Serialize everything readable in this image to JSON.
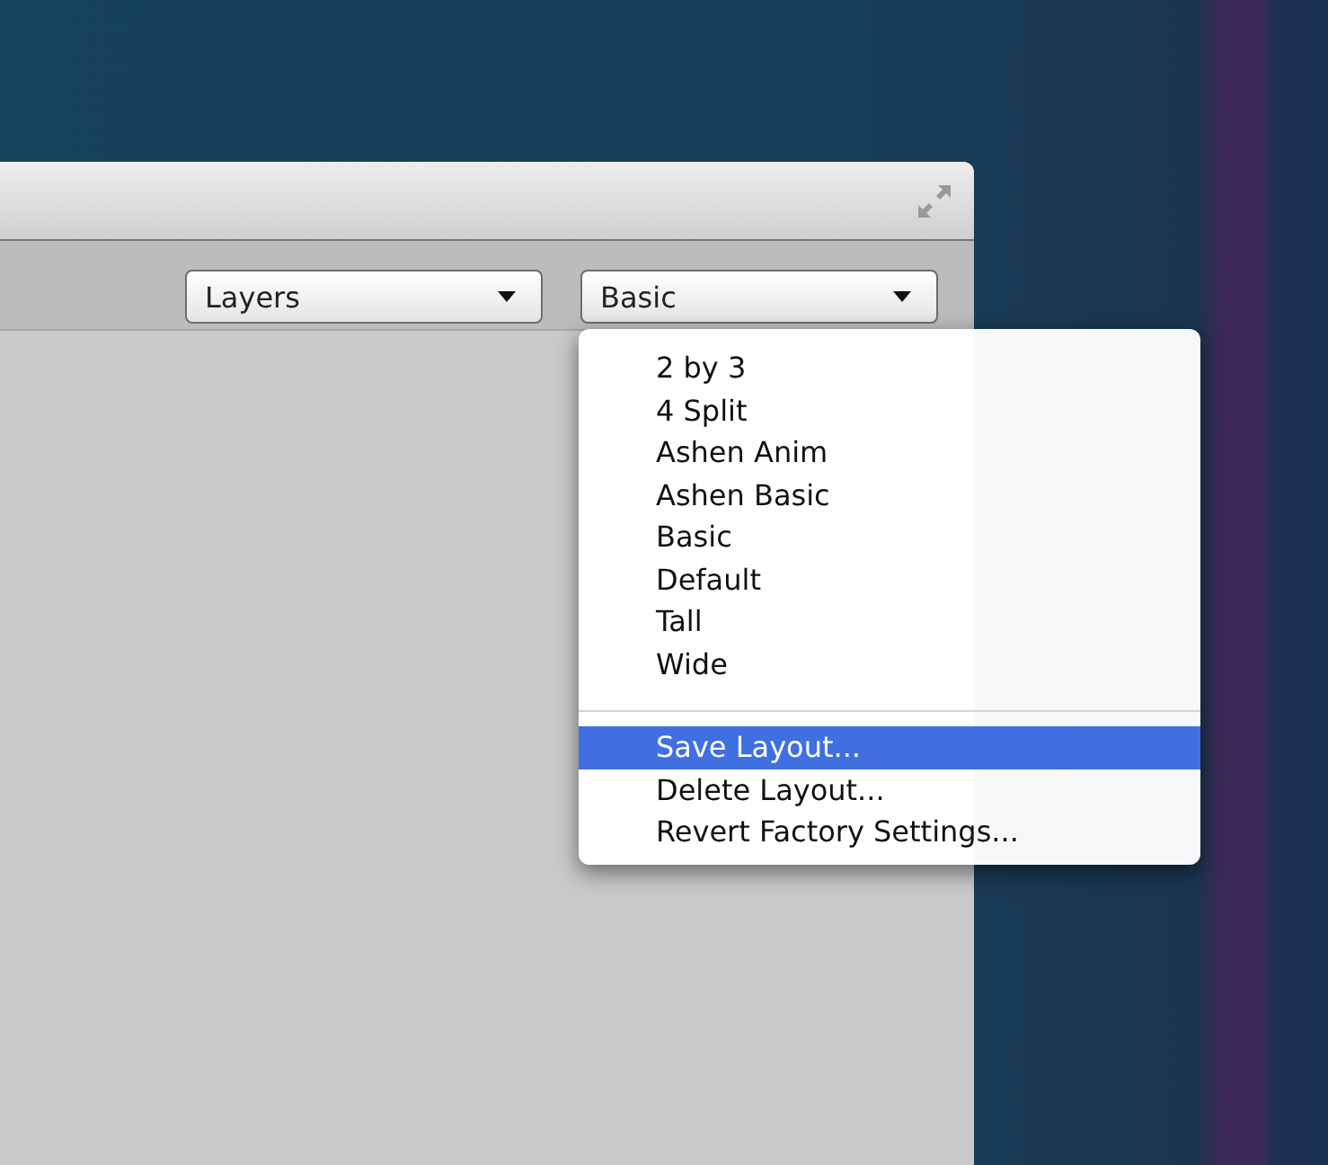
{
  "toolbar": {
    "dropdowns": [
      {
        "label": "Layers"
      },
      {
        "label": "Basic"
      }
    ]
  },
  "menu": {
    "groups": [
      [
        {
          "label": "2 by 3",
          "selected": false
        },
        {
          "label": "4 Split",
          "selected": false
        },
        {
          "label": "Ashen Anim",
          "selected": false
        },
        {
          "label": "Ashen Basic",
          "selected": false
        },
        {
          "label": "Basic",
          "selected": false
        },
        {
          "label": "Default",
          "selected": false
        },
        {
          "label": "Tall",
          "selected": false
        },
        {
          "label": "Wide",
          "selected": false
        }
      ],
      [
        {
          "label": "Save Layout...",
          "selected": true
        },
        {
          "label": "Delete Layout...",
          "selected": false
        },
        {
          "label": "Revert Factory Settings...",
          "selected": false
        }
      ]
    ]
  }
}
